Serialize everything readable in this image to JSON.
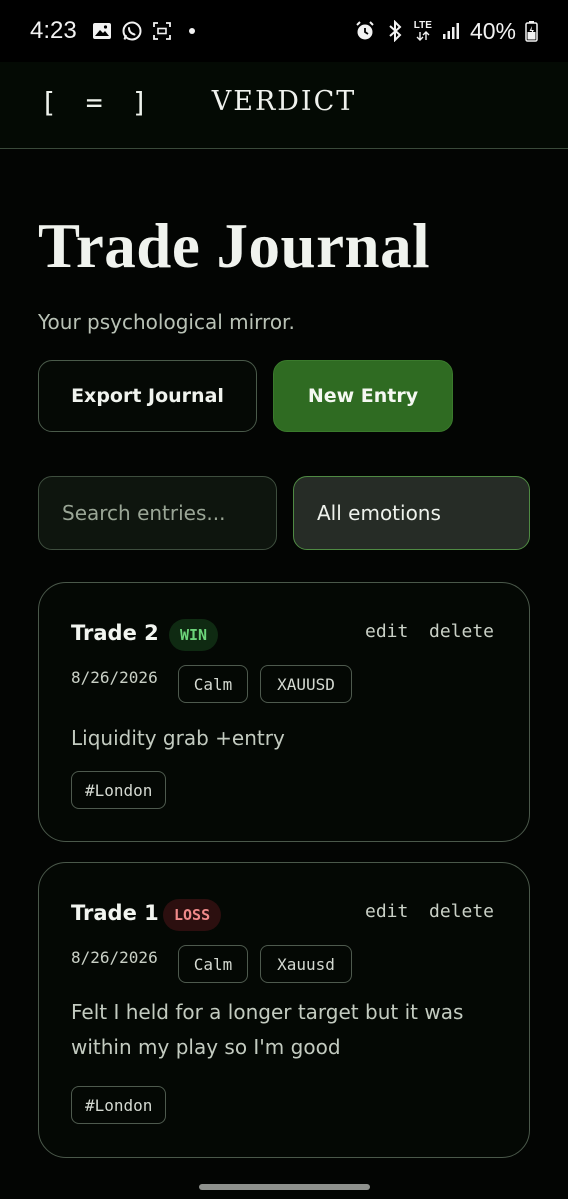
{
  "status_bar": {
    "time": "4:23",
    "network": "LTE",
    "battery": "40%",
    "left_icons": [
      "gallery-icon",
      "whatsapp-icon",
      "screenshot-icon",
      "dot-icon"
    ],
    "right_icons": [
      "alarm-icon",
      "bluetooth-icon",
      "lte-icon",
      "signal-icon",
      "battery-icon"
    ]
  },
  "header": {
    "menu_glyph": "[ = ]",
    "brand": "VERDICT"
  },
  "page": {
    "title": "Trade Journal",
    "subtitle": "Your psychological mirror."
  },
  "actions": {
    "export_label": "Export Journal",
    "new_entry_label": "New Entry"
  },
  "filters": {
    "search_placeholder": "Search entries...",
    "emotion_selected": "All emotions"
  },
  "entries": [
    {
      "title": "Trade 2",
      "result": "WIN",
      "edit_label": "edit",
      "delete_label": "delete",
      "date": "8/26/2026",
      "emotion": "Calm",
      "symbol": "XAUUSD",
      "note": "Liquidity grab +entry",
      "tag": "#London"
    },
    {
      "title": "Trade 1",
      "result": "LOSS",
      "edit_label": "edit",
      "delete_label": "delete",
      "date": "8/26/2026",
      "emotion": "Calm",
      "symbol": "Xauusd",
      "note": "Felt I held for a longer target but it was within my play so I'm good",
      "tag": "#London"
    }
  ],
  "colors": {
    "background": "#030503",
    "accent_green": "#2f6b22",
    "win": "#6cd47a",
    "loss": "#f08a8a"
  }
}
